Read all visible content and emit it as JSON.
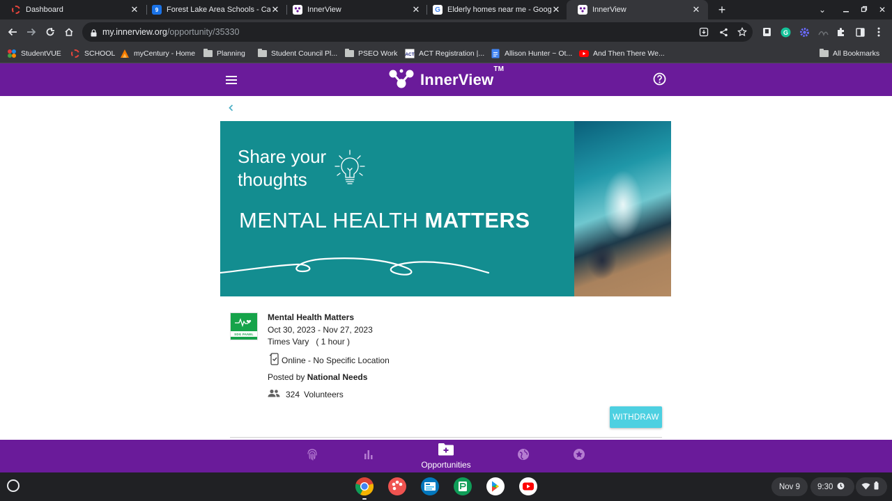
{
  "browser": {
    "tabs": [
      {
        "title": "Dashboard",
        "favicon": "schoology-ring-icon"
      },
      {
        "title": "Forest Lake Area Schools - Calen",
        "favicon": "calendar-icon"
      },
      {
        "title": "InnerView",
        "favicon": "innerview-icon"
      },
      {
        "title": "Elderly homes near me - Google",
        "favicon": "google-icon"
      },
      {
        "title": "InnerView",
        "favicon": "innerview-icon"
      }
    ],
    "url_host": "my.innerview.org",
    "url_path": "/opportunity/35330",
    "bookmarks": [
      {
        "label": "StudentVUE"
      },
      {
        "label": "SCHOOL"
      },
      {
        "label": "myCentury - Home"
      },
      {
        "label": "Planning"
      },
      {
        "label": "Student Council Pl..."
      },
      {
        "label": "PSEO Work"
      },
      {
        "label": "ACT Registration |..."
      },
      {
        "label": "Allison Hunter ~ Ot..."
      },
      {
        "label": "And Then There We..."
      }
    ],
    "all_bookmarks": "All Bookmarks"
  },
  "app": {
    "brand": "InnerView",
    "trademark": "TM",
    "accent": "#6a1b9a"
  },
  "banner": {
    "line1": "Share your",
    "line2": "thoughts",
    "headline_regular": "MENTAL HEALTH ",
    "headline_bold": "MATTERS",
    "bg_color": "#138d90"
  },
  "opportunity": {
    "logo_text": "SDG PANEL",
    "title": "Mental Health Matters",
    "dates": "Oct 30, 2023 - Nov 27, 2023",
    "times": "Times Vary   ( 1 hour )",
    "location": "Online - No Specific Location",
    "posted_prefix": "Posted by ",
    "posted_by": "National Needs",
    "volunteer_count": "324",
    "volunteer_label": "Volunteers",
    "action_label": "WITHDRAW"
  },
  "bottom_nav": {
    "active_label": "Opportunities"
  },
  "shelf": {
    "date": "Nov 9",
    "time": "9:30"
  }
}
